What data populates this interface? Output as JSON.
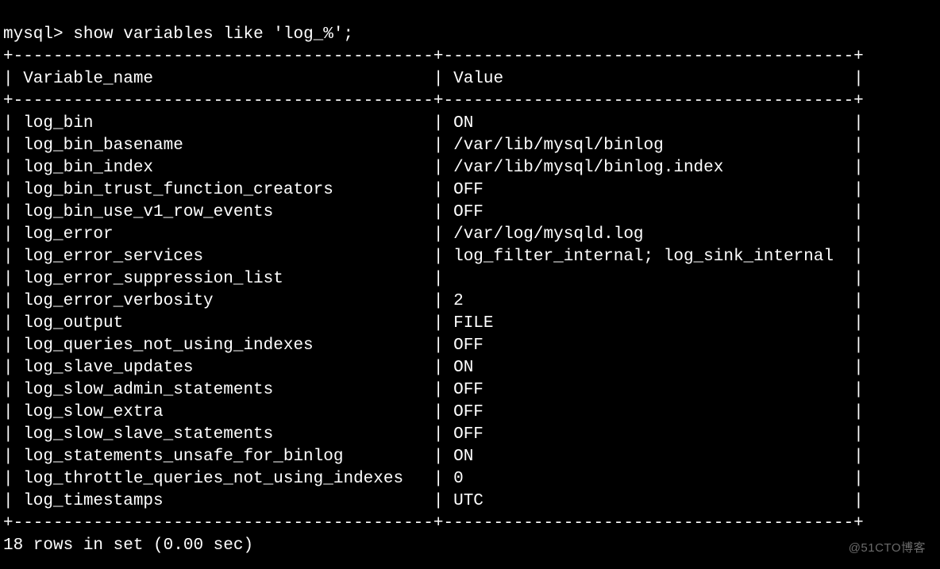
{
  "terminal": {
    "prompt": "mysql>",
    "command": "show variables like 'log_%';",
    "headers": {
      "col1": "Variable_name",
      "col2": "Value"
    },
    "rows": [
      {
        "name": "log_bin",
        "value": "ON"
      },
      {
        "name": "log_bin_basename",
        "value": "/var/lib/mysql/binlog"
      },
      {
        "name": "log_bin_index",
        "value": "/var/lib/mysql/binlog.index"
      },
      {
        "name": "log_bin_trust_function_creators",
        "value": "OFF"
      },
      {
        "name": "log_bin_use_v1_row_events",
        "value": "OFF"
      },
      {
        "name": "log_error",
        "value": "/var/log/mysqld.log"
      },
      {
        "name": "log_error_services",
        "value": "log_filter_internal; log_sink_internal"
      },
      {
        "name": "log_error_suppression_list",
        "value": ""
      },
      {
        "name": "log_error_verbosity",
        "value": "2"
      },
      {
        "name": "log_output",
        "value": "FILE"
      },
      {
        "name": "log_queries_not_using_indexes",
        "value": "OFF"
      },
      {
        "name": "log_slave_updates",
        "value": "ON"
      },
      {
        "name": "log_slow_admin_statements",
        "value": "OFF"
      },
      {
        "name": "log_slow_extra",
        "value": "OFF"
      },
      {
        "name": "log_slow_slave_statements",
        "value": "OFF"
      },
      {
        "name": "log_statements_unsafe_for_binlog",
        "value": "ON"
      },
      {
        "name": "log_throttle_queries_not_using_indexes",
        "value": "0"
      },
      {
        "name": "log_timestamps",
        "value": "UTC"
      }
    ],
    "footer": "18 rows in set (0.00 sec)",
    "col1_width": 40,
    "col2_width": 39
  },
  "watermark": "@51CTO博客"
}
